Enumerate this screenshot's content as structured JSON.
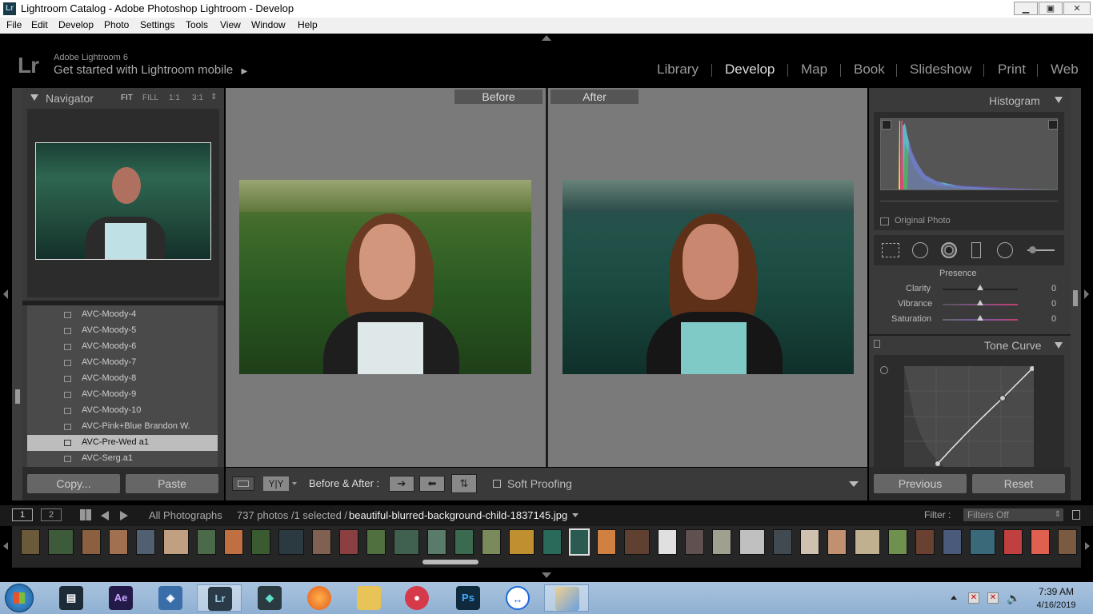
{
  "window": {
    "title": "Lightroom Catalog - Adobe Photoshop Lightroom - Develop",
    "app_icon": "Lr",
    "min_icon": "minimize-icon",
    "max_icon": "maximize-icon",
    "close_label": "✕"
  },
  "menu": [
    "File",
    "Edit",
    "Develop",
    "Photo",
    "Settings",
    "Tools",
    "View",
    "Window",
    "Help"
  ],
  "header": {
    "logo": "Lr",
    "version": "Adobe Lightroom 6",
    "mobile": "Get started with Lightroom mobile",
    "mobile_arrow": "▶",
    "modules": [
      "Library",
      "Develop",
      "Map",
      "Book",
      "Slideshow",
      "Print",
      "Web"
    ],
    "active_module": "Develop"
  },
  "navigator": {
    "title": "Navigator",
    "zoom_options": [
      "FIT",
      "FILL",
      "1:1",
      "3:1"
    ],
    "zoom_arrow": "⇕"
  },
  "presets": [
    "AVC-Moody-4",
    "AVC-Moody-5",
    "AVC-Moody-6",
    "AVC-Moody-7",
    "AVC-Moody-8",
    "AVC-Moody-9",
    "AVC-Moody-10",
    "AVC-Pink+Blue Brandon W.",
    "AVC-Pre-Wed a1",
    "AVC-Serg.a1"
  ],
  "selected_preset": "AVC-Pre-Wed a1",
  "left_buttons": {
    "copy": "Copy...",
    "paste": "Paste"
  },
  "compare": {
    "before": "Before",
    "after": "After"
  },
  "toolbar": {
    "view_yy": "Y|Y",
    "before_after_label": "Before & After :",
    "soft_proofing": "Soft Proofing"
  },
  "right_panel": {
    "histogram_title": "Histogram",
    "original_photo": "Original Photo",
    "presence_title": "Presence",
    "sliders": [
      {
        "label": "Clarity",
        "value": "0"
      },
      {
        "label": "Vibrance",
        "value": "0"
      },
      {
        "label": "Saturation",
        "value": "0"
      }
    ],
    "tone_curve_title": "Tone Curve",
    "previous": "Previous",
    "reset": "Reset"
  },
  "filmstrip_bar": {
    "page1": "1",
    "page2": "2",
    "source": "All Photographs",
    "count": "737 photos /1 selected /",
    "filename": "beautiful-blurred-background-child-1837145.jpg",
    "filter_label": "Filter :",
    "filter_value": "Filters Off"
  },
  "taskbar": {
    "time": "7:39 AM",
    "date": "4/16/2019",
    "apps": [
      "Windows Media",
      "Ae",
      "Network",
      "Lr",
      "Filmora",
      "Firefox",
      "Explorer",
      "Camera",
      "Ps",
      "TeamViewer",
      "Paint"
    ]
  },
  "colors": {
    "panel": "#3a3a3a",
    "canvas": "#7a7a7a",
    "selected_row": "#bdbdbd",
    "button": "#666666"
  }
}
